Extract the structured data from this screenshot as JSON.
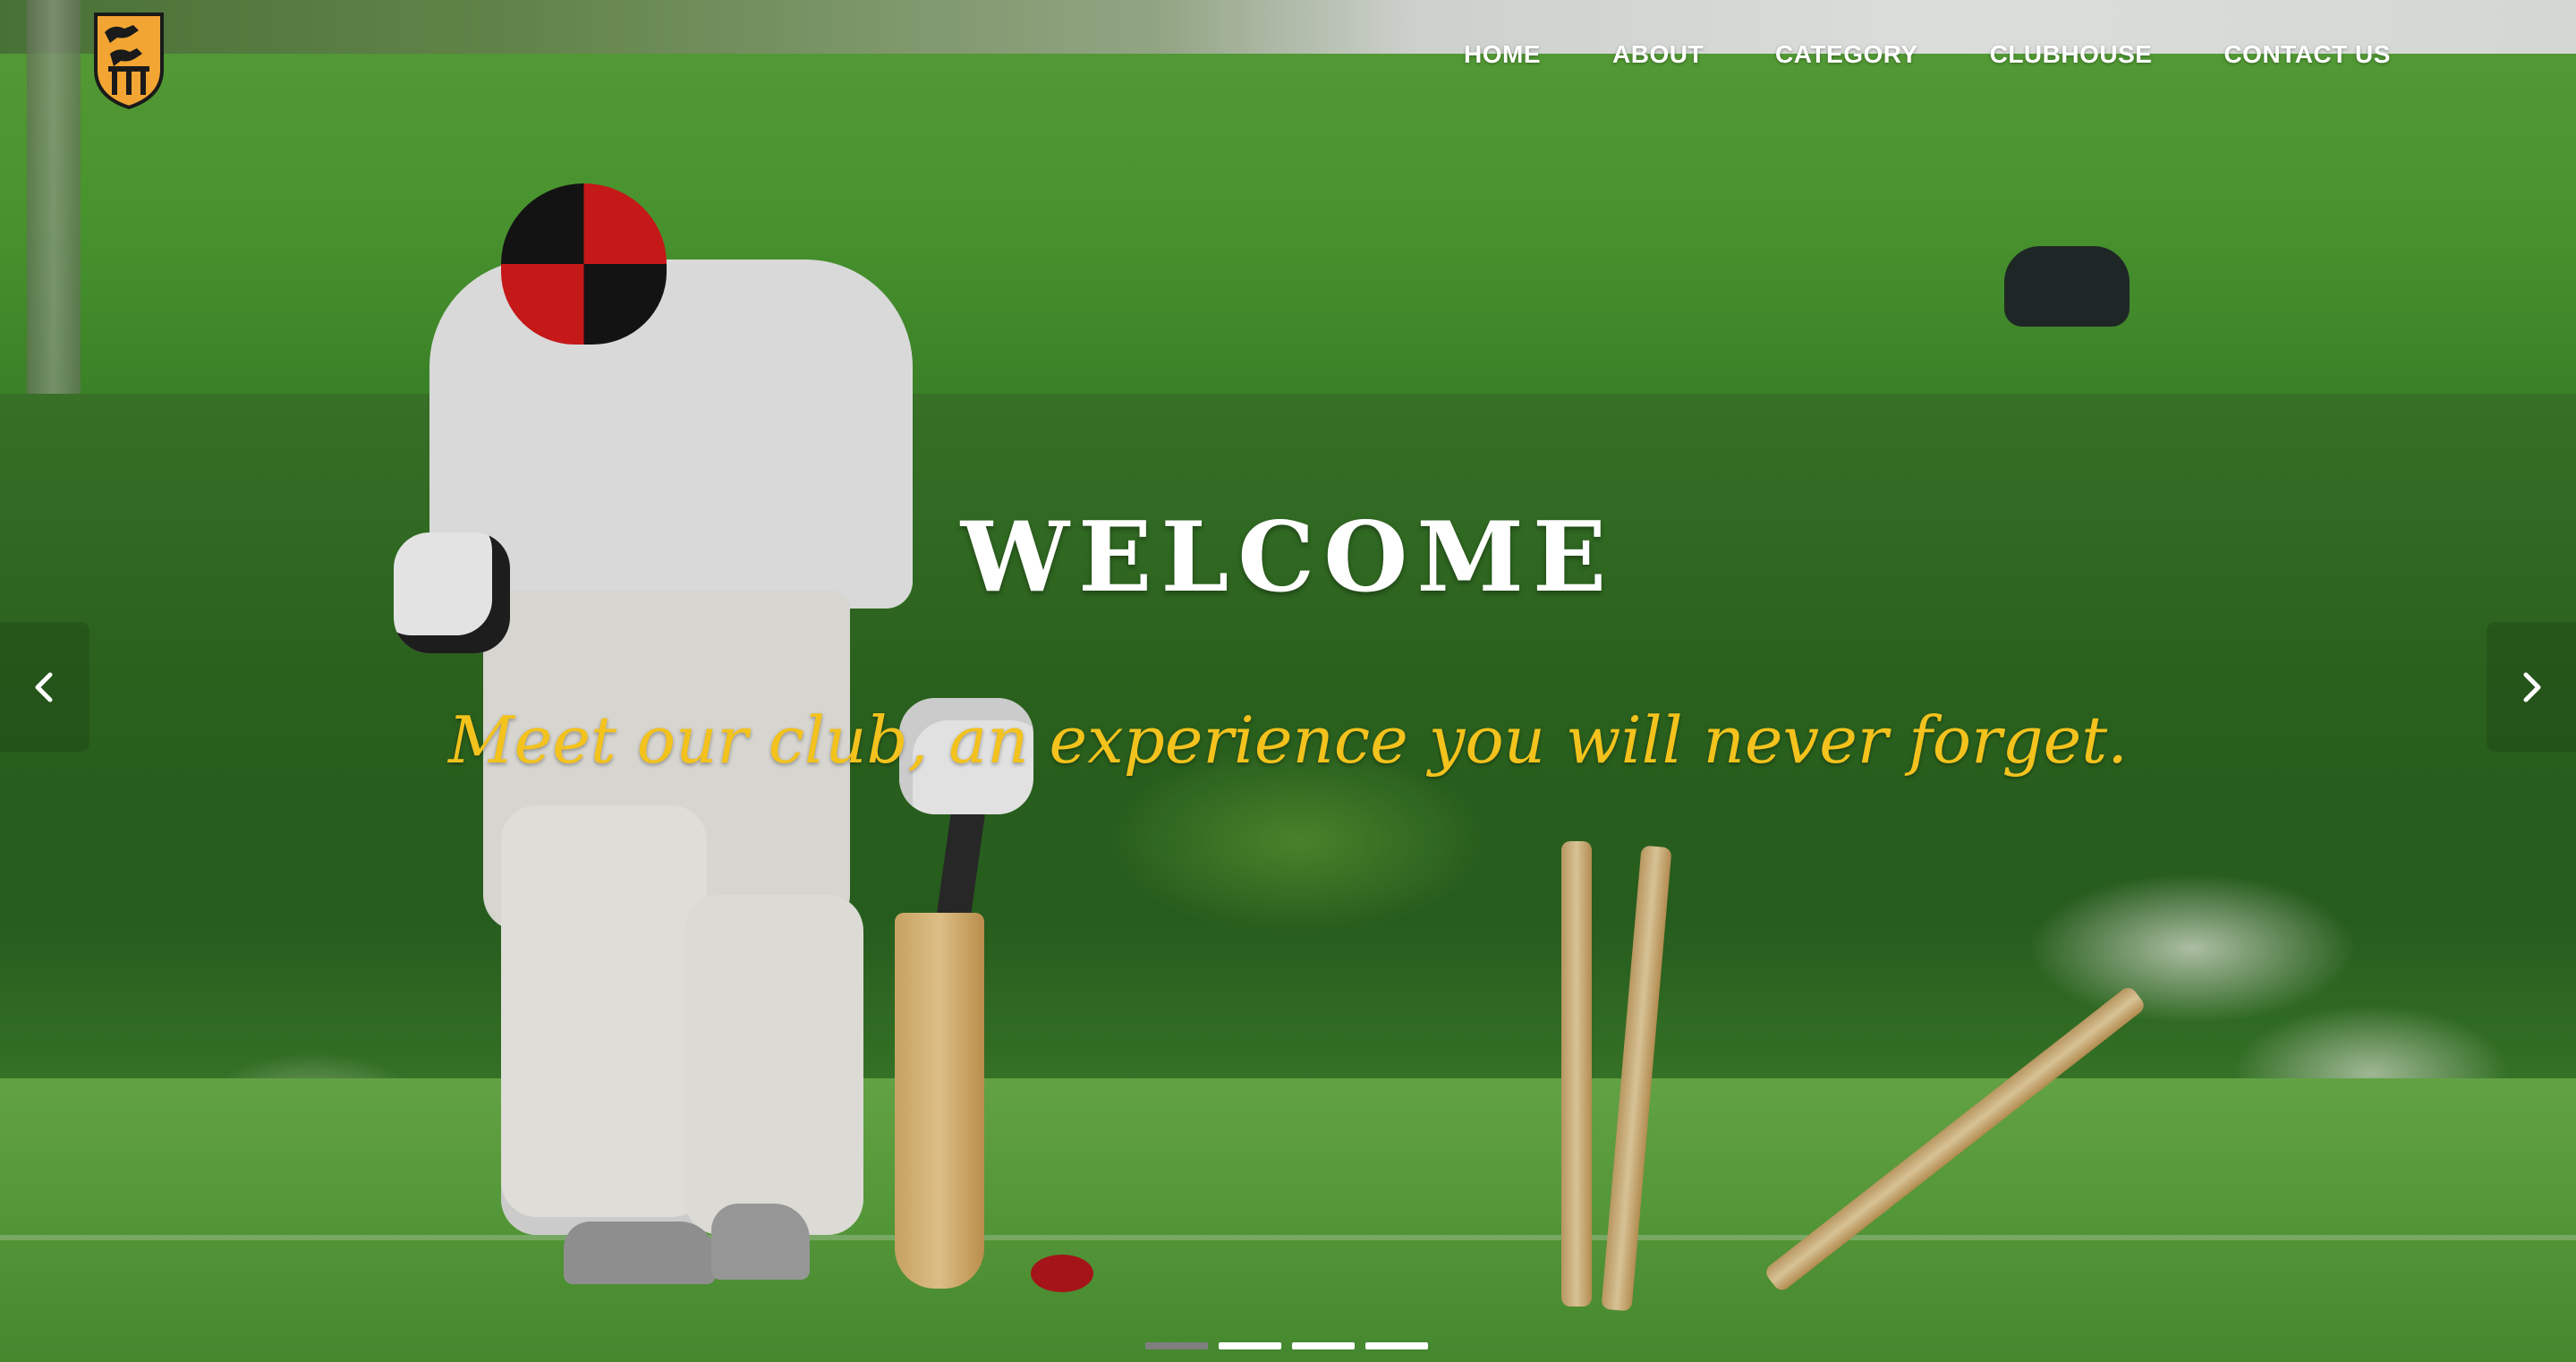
{
  "nav": {
    "items": [
      {
        "label": "HOME"
      },
      {
        "label": "ABOUT"
      },
      {
        "label": "CATEGORY"
      },
      {
        "label": "CLUBHOUSE"
      },
      {
        "label": "CONTACT US"
      }
    ]
  },
  "logo": {
    "icon": "club-crest",
    "colors": {
      "fill": "#f2a532",
      "stroke": "#1a1a1a"
    }
  },
  "hero": {
    "title": "WELCOME",
    "tagline": "Meet our club, an experience you will never forget.",
    "colors": {
      "title": "#ffffff",
      "tagline": "#f3c21d"
    }
  },
  "carousel": {
    "prev_icon": "chevron-left-icon",
    "next_icon": "chevron-right-icon",
    "slide_count": 4,
    "active_index": 0
  }
}
